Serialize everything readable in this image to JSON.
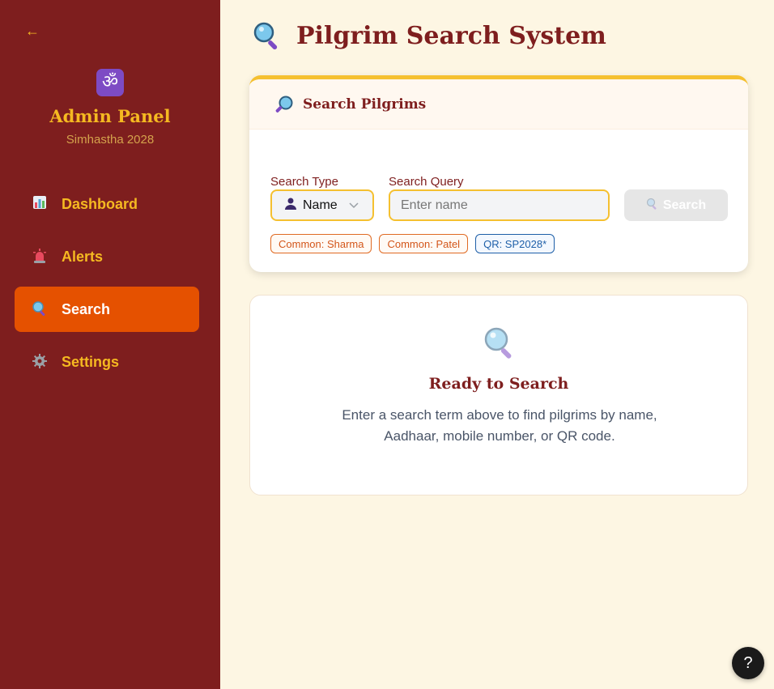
{
  "sidebar": {
    "back_icon": "arrow-left-icon",
    "logo_icon": "om-icon",
    "logo_glyph": "ॐ",
    "title": "Admin Panel",
    "subtitle": "Simhastha 2028",
    "items": [
      {
        "label": "Dashboard",
        "icon": "bar-chart-icon",
        "glyph": "▮",
        "active": false
      },
      {
        "label": "Alerts",
        "icon": "siren-icon",
        "glyph": "🚨",
        "active": false
      },
      {
        "label": "Search",
        "icon": "magnifier-icon",
        "glyph": "🔍",
        "active": true
      },
      {
        "label": "Settings",
        "icon": "gear-icon",
        "glyph": "⚙",
        "active": false
      }
    ]
  },
  "header": {
    "title": "Pilgrim Search System",
    "icon": "magnifier-icon"
  },
  "search_card": {
    "title": "Search Pilgrims",
    "search_type_label": "Search Type",
    "search_type_value": "Name",
    "search_query_label": "Search Query",
    "search_query_placeholder": "Enter name",
    "search_query_value": "",
    "search_button_label": "Search",
    "chips": [
      {
        "label": "Common: Sharma",
        "kind": "common"
      },
      {
        "label": "Common: Patel",
        "kind": "common"
      },
      {
        "label": "QR: SP2028*",
        "kind": "qr"
      }
    ]
  },
  "empty_state": {
    "title": "Ready to Search",
    "description": "Enter a search term above to find pilgrims by name, Aadhaar, mobile number, or QR code."
  },
  "help": {
    "label": "?"
  },
  "colors": {
    "sidebar_bg": "#7e1e1e",
    "accent_gold": "#f5b921",
    "active_nav": "#e55100",
    "page_bg": "#fdf6e3"
  }
}
